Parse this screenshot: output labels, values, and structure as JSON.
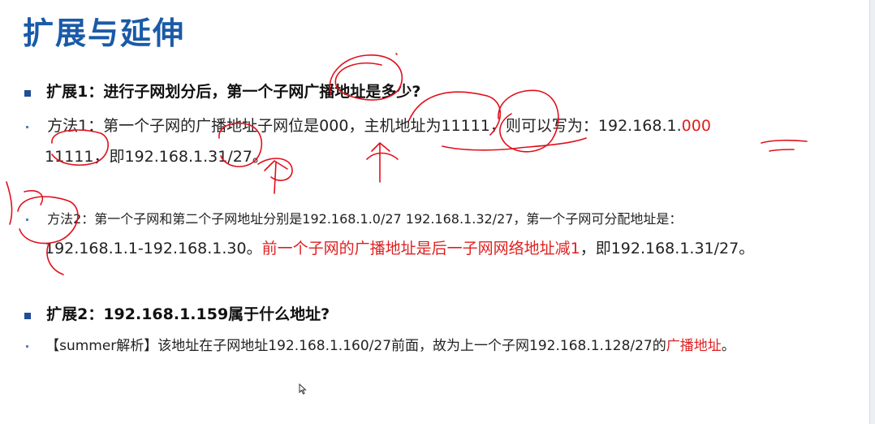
{
  "slide": {
    "title": "扩展与延伸",
    "ext1": {
      "heading": "扩展1：进行子网划分后，第一个子网广播地址是多少?",
      "m1_line1_prefix": "方法1：第一个子网的广播地址子网位是000，主机地址为11111，则可以写为：192.168.1.",
      "m1_line1_red": "000",
      "m1_line2": "11111，即192.168.1.31/27。",
      "m2_line1": "方法2：第一个子网和第二个子网地址分别是192.168.1.0/27   192.168.1.32/27，第一个子网可分配地址是：",
      "m2_line2_prefix": "192.168.1.1-192.168.1.30。",
      "m2_line2_red": "前一个子网的广播地址是后一子网网络地址减1",
      "m2_line2_suffix": "，即192.168.1.31/27。"
    },
    "ext2": {
      "heading": "扩展2：192.168.1.159属于什么地址?",
      "answer_prefix": "【summer解析】该地址在子网地址192.168.1.160/27前面，故为上一个子网192.168.1.128/27的",
      "answer_red": "广播地址",
      "answer_suffix": "。"
    }
  },
  "colors": {
    "title": "#1a5aa8",
    "bullet": "#1f4e96",
    "highlight": "#e02020",
    "ink": "#e0101c"
  },
  "icons": [
    "square-bullet-icon",
    "dot-bullet-icon",
    "mouse-cursor-icon"
  ]
}
